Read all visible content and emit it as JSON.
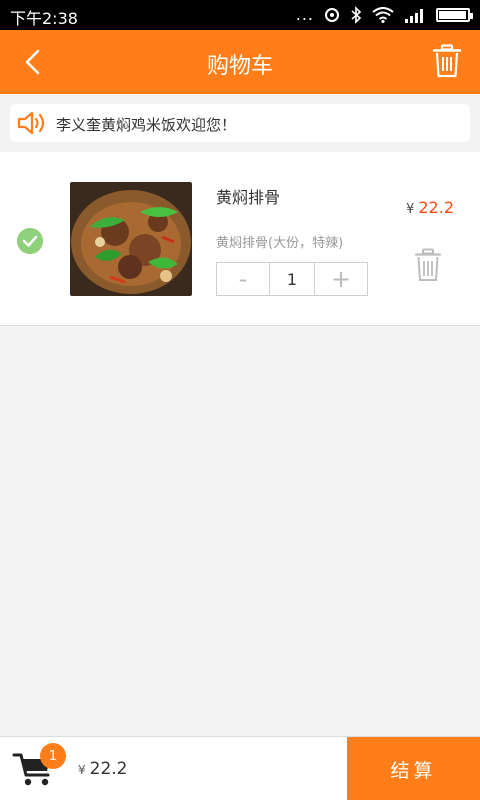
{
  "status_bar": {
    "time": "下午2:38",
    "more": "...",
    "battery_level": 0.95
  },
  "header": {
    "title": "购物车",
    "back_icon": "chevron-left-icon",
    "delete_all_icon": "trash-icon"
  },
  "notice": {
    "icon": "speaker-icon",
    "text": "李义奎黄焖鸡米饭欢迎您！"
  },
  "cart_items": [
    {
      "name": "黄焖排骨",
      "spec": "黄焖排骨(大份，特辣)",
      "currency": "¥",
      "price": "22.2",
      "quantity": "1",
      "minus_label": "-",
      "plus_label": "+",
      "selected": true
    }
  ],
  "bottom": {
    "badge_count": "1",
    "currency": "¥",
    "total": "22.2",
    "checkout_label": "结算"
  },
  "colors": {
    "accent": "#ff7e1a",
    "price": "#ff4a14",
    "check": "#8fd07b"
  }
}
